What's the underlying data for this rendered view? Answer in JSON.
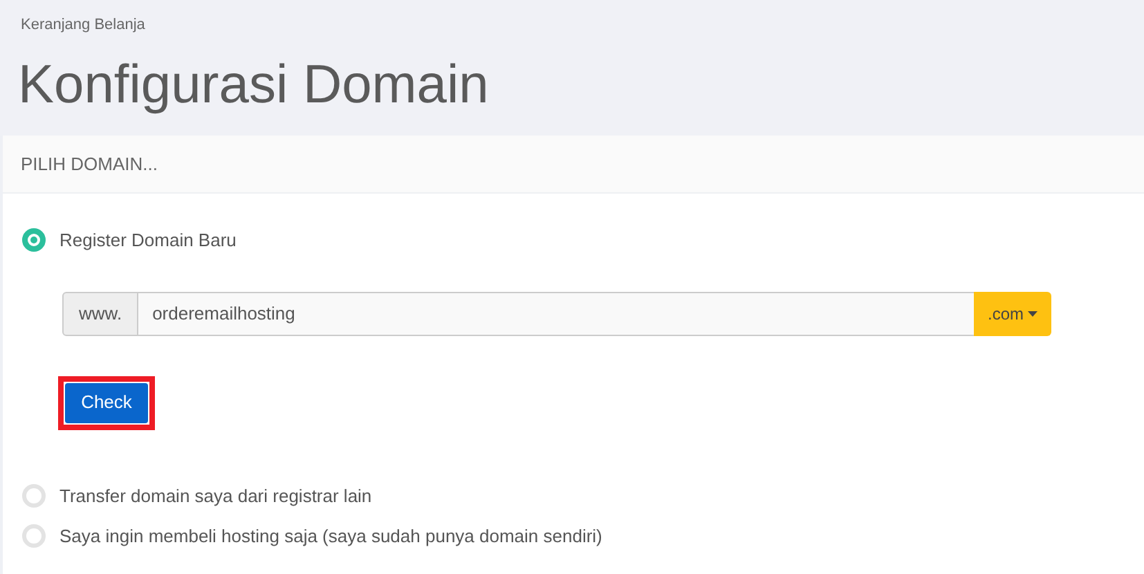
{
  "breadcrumb": "Keranjang Belanja",
  "title": "Konfigurasi Domain",
  "panel": {
    "heading": "PILIH DOMAIN...",
    "options": [
      {
        "label": "Register Domain Baru",
        "selected": true
      },
      {
        "label": "Transfer domain saya dari registrar lain",
        "selected": false
      },
      {
        "label": "Saya ingin membeli hosting saja (saya sudah punya domain sendiri)",
        "selected": false
      }
    ],
    "domain": {
      "prefix": "www.",
      "value": "orderemailhosting",
      "tld": ".com"
    },
    "check_button": {
      "label": "Check",
      "highlighted": true
    }
  }
}
